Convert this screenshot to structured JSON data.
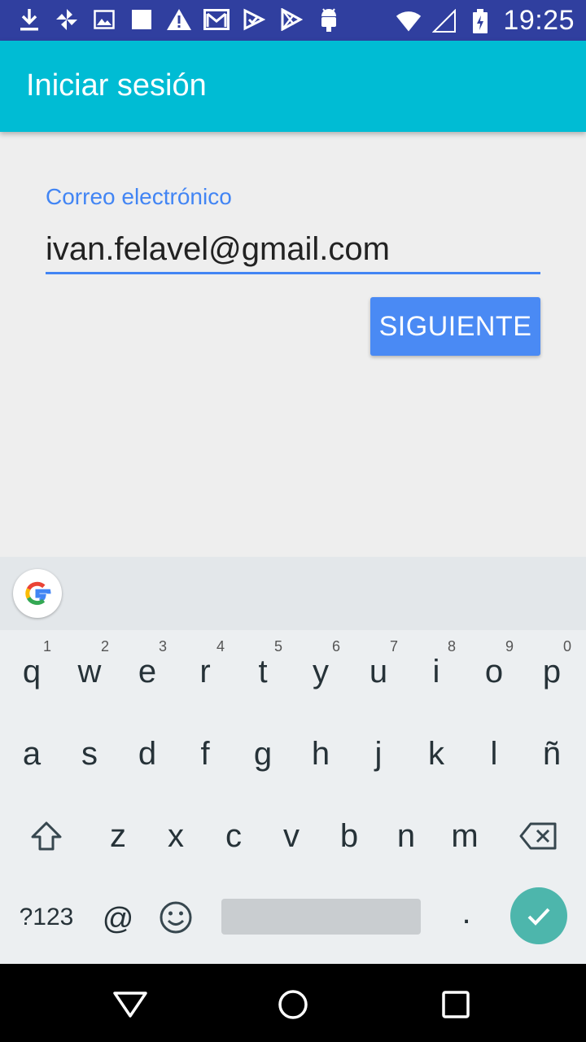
{
  "status_bar": {
    "time": "19:25",
    "left_icons": [
      "download-icon",
      "pinwheel-icon",
      "image-icon",
      "square-icon",
      "warning-icon",
      "gmail-icon",
      "check-flag-icon",
      "play-store-icon",
      "android-icon"
    ],
    "right_icons": [
      "wifi-icon",
      "signal-icon",
      "battery-icon"
    ]
  },
  "appbar": {
    "title": "Iniciar sesión",
    "color": "#00bcd4"
  },
  "form": {
    "email_label": "Correo electrónico",
    "email_value": "ivan.felavel@gmail.com",
    "next_button": "SIGUIENTE",
    "accent": "#4285f4"
  },
  "keyboard": {
    "row1": [
      {
        "key": "q",
        "hint": "1"
      },
      {
        "key": "w",
        "hint": "2"
      },
      {
        "key": "e",
        "hint": "3"
      },
      {
        "key": "r",
        "hint": "4"
      },
      {
        "key": "t",
        "hint": "5"
      },
      {
        "key": "y",
        "hint": "6"
      },
      {
        "key": "u",
        "hint": "7"
      },
      {
        "key": "i",
        "hint": "8"
      },
      {
        "key": "o",
        "hint": "9"
      },
      {
        "key": "p",
        "hint": "0"
      }
    ],
    "row2": [
      "a",
      "s",
      "d",
      "f",
      "g",
      "h",
      "j",
      "k",
      "l",
      "ñ"
    ],
    "row3": [
      "z",
      "x",
      "c",
      "v",
      "b",
      "n",
      "m"
    ],
    "symbols_key": "?123",
    "at_key": "@",
    "period_key": ".",
    "enter_color": "#4db6ac"
  },
  "nav_bar": {
    "icons": [
      "back-icon",
      "home-icon",
      "recents-icon"
    ]
  }
}
